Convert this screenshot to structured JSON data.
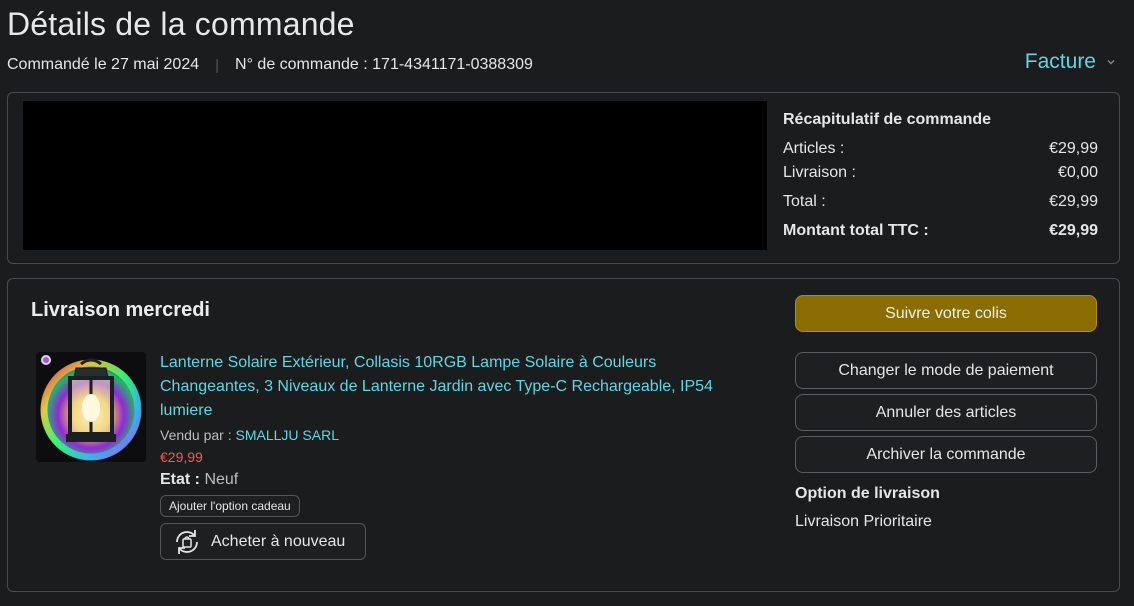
{
  "header": {
    "title": "Détails de la commande",
    "ordered_on": "Commandé le 27 mai 2024",
    "separator": "|",
    "order_number": "N° de commande : 171-4341171-0388309",
    "invoice_label": "Facture"
  },
  "summary": {
    "title": "Récapitulatif de commande",
    "rows": [
      {
        "label": "Articles :",
        "value": "€29,99"
      },
      {
        "label": "Livraison :",
        "value": "€0,00"
      },
      {
        "label": "Total :",
        "value": "€29,99"
      },
      {
        "label": "Montant total TTC :",
        "value": "€29,99"
      }
    ]
  },
  "delivery": {
    "title": "Livraison mercredi",
    "product": {
      "title": "Lanterne Solaire Extérieur, Collasis 10RGB Lampe Solaire à Couleurs Changeantes, 3 Niveaux de Lanterne Jardin avec Type-C Rechargeable, IP54 lumiere",
      "sold_by_label": "Vendu par :",
      "seller": "SMALLJU SARL",
      "price": "€29,99",
      "condition_label": "Etat :",
      "condition_value": "Neuf",
      "gift_label": "Ajouter l'option cadeau",
      "rebuy_label": "Acheter à nouveau"
    },
    "actions": {
      "track": "Suivre votre colis",
      "change_payment": "Changer le mode de paiement",
      "cancel_items": "Annuler des articles",
      "archive": "Archiver la commande"
    },
    "shipping_option_title": "Option de livraison",
    "shipping_option_value": "Livraison Prioritaire"
  },
  "colors": {
    "link": "#5fd6e3",
    "price": "#f05a4f",
    "primary_button": "#8a6d00",
    "background": "#1b1c1e"
  },
  "icons": [
    "chevron-down-icon",
    "rebuy-icon"
  ]
}
